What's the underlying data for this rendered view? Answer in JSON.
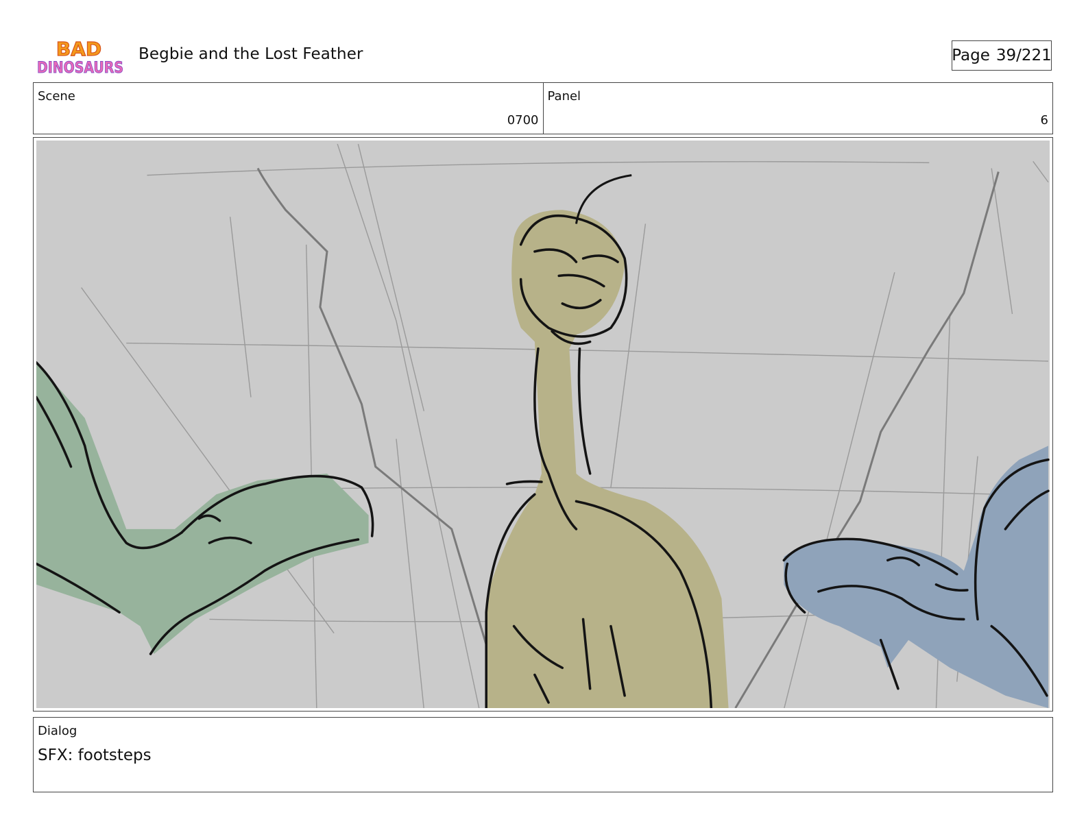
{
  "header": {
    "logo": {
      "line1": "BAD",
      "line2": "DINOSAURS",
      "icon": "bad-dinosaurs-logo"
    },
    "project_title": "Begbie and the Lost Feather",
    "page_label": "Page",
    "page_number": "39/221"
  },
  "panel_info": {
    "scene_label": "Scene",
    "scene_value": "0700",
    "panel_label": "Panel",
    "panel_value": "6"
  },
  "frame": {
    "icon": "storyboard-sketch-image",
    "colors": {
      "background": "#cbcbcb",
      "green_dino": "#97b39c",
      "yellow_dino": "#b7b289",
      "blue_dino": "#8fa3ba",
      "ink": "#141414"
    }
  },
  "dialog": {
    "label": "Dialog",
    "text": "SFX: footsteps"
  }
}
